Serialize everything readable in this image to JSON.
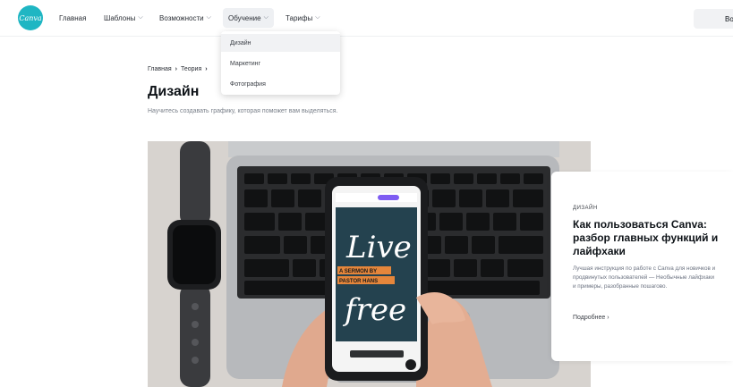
{
  "header": {
    "logo_text": "Canva",
    "nav": [
      {
        "label": "Главная",
        "chevron": false
      },
      {
        "label": "Шаблоны",
        "chevron": true
      },
      {
        "label": "Возможности",
        "chevron": true
      },
      {
        "label": "Обучение",
        "chevron": true,
        "active": true
      },
      {
        "label": "Тарифы",
        "chevron": true
      }
    ],
    "right_button_label": "Во"
  },
  "dropdown": {
    "items": [
      "Дизайн",
      "Маркетинг",
      "Фотография"
    ]
  },
  "breadcrumb": {
    "items": [
      "Главная",
      "Теория"
    ],
    "separator": "›"
  },
  "page": {
    "title": "Дизайн",
    "subtitle": "Научитесь создавать графику, которая поможет вам выделяться."
  },
  "feature_card": {
    "category": "ДИЗАЙН",
    "title": "Как пользоваться Canva: разбор главных функций и лайфхаки",
    "description": "Лучшая инструкция по работе с Canva для новичков и продвинутых пользователей — Необычные лайфхаки и примеры, разобранные пошагово.",
    "link": "Подробнее ›"
  },
  "hero_image": {
    "poster_lines": [
      "Live",
      "A SERMON BY",
      "PASTOR HANS",
      "free"
    ]
  },
  "colors": {
    "brand": "#1fb6c3",
    "poster_bg": "#24424f",
    "poster_accent": "#e5863b"
  }
}
